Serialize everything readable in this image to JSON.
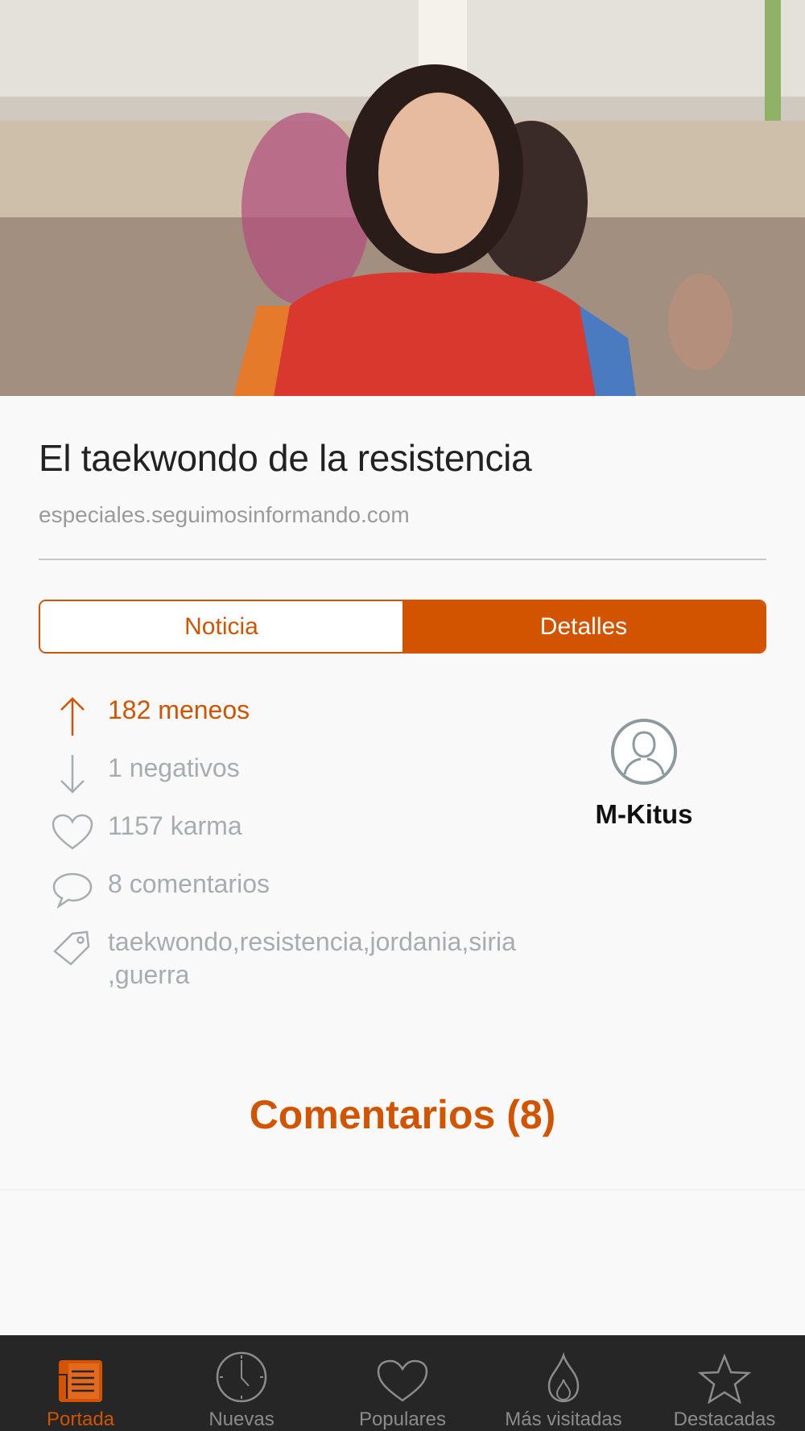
{
  "article": {
    "title": "El taekwondo de la resistencia",
    "domain": "especiales.seguimosinformando.com"
  },
  "segmented": {
    "noticia": "Noticia",
    "detalles": "Detalles",
    "active": "Detalles"
  },
  "stats": {
    "meneos": "182 meneos",
    "negativos": "1 negativos",
    "karma": "1157 karma",
    "comentarios": "8 comentarios",
    "tags": "taekwondo,resistencia,jordania,siria ,guerra"
  },
  "user": {
    "name": "M-Kitus"
  },
  "comments": {
    "heading": "Comentarios (8)"
  },
  "tabbar": {
    "items": [
      {
        "label": "Portada",
        "icon": "newspaper-icon",
        "active": true
      },
      {
        "label": "Nuevas",
        "icon": "clock-icon"
      },
      {
        "label": "Populares",
        "icon": "heart-icon"
      },
      {
        "label": "Más visitadas",
        "icon": "flame-icon"
      },
      {
        "label": "Destacadas",
        "icon": "star-icon"
      }
    ]
  },
  "colors": {
    "accent": "#d35400",
    "muted_text": "#a6adb0",
    "tabbar_bg": "#262626"
  }
}
